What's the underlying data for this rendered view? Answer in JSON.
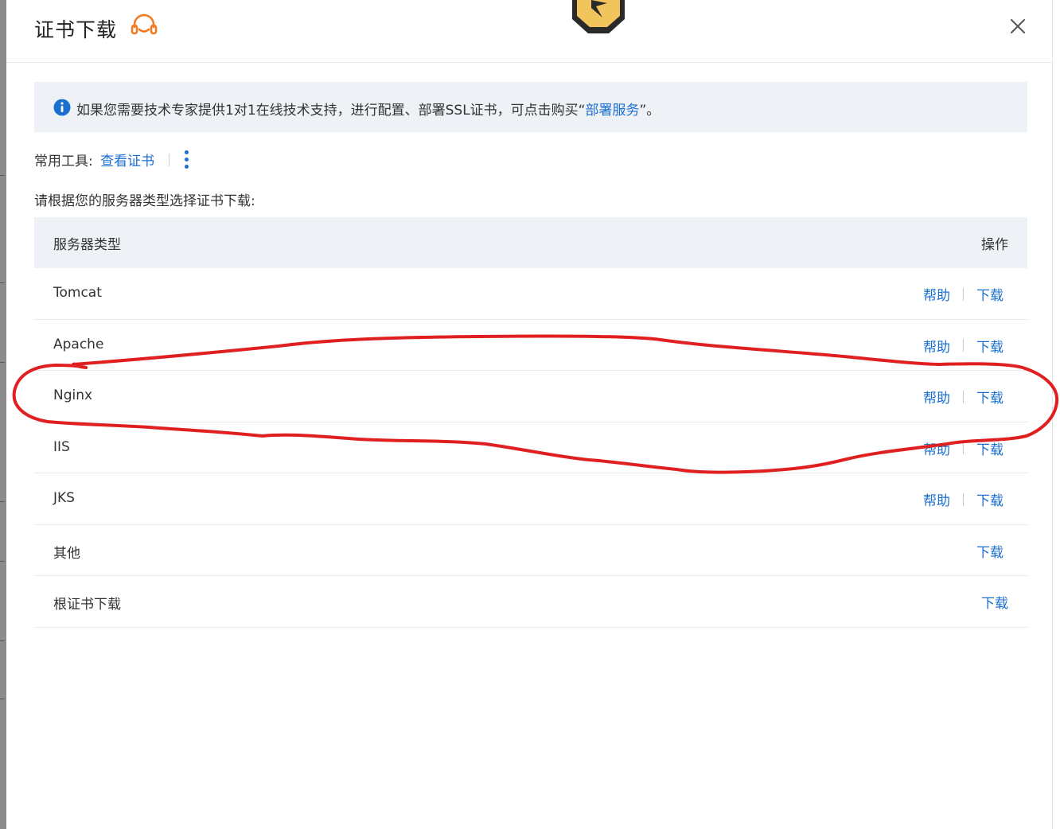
{
  "dialog": {
    "title": "证书下载",
    "close_icon": "close-icon",
    "support_icon": "headset-icon"
  },
  "notice": {
    "icon": "info-icon",
    "text_before": "如果您需要技术专家提供1对1在线技术支持，进行配置、部署SSL证书，可点击购买“",
    "link_text": "部署服务",
    "text_after": "”。"
  },
  "tools": {
    "label": "常用工具:",
    "view_cert": "查看证书",
    "more_icon": "more-vertical-icon"
  },
  "instruction": "请根据您的服务器类型选择证书下载:",
  "table": {
    "col_type": "服务器类型",
    "col_op": "操作",
    "rows": [
      {
        "name": "Tomcat",
        "help": "帮助",
        "download": "下载"
      },
      {
        "name": "Apache",
        "help": "帮助",
        "download": "下载"
      },
      {
        "name": "Nginx",
        "help": "帮助",
        "download": "下载"
      },
      {
        "name": "IIS",
        "help": "帮助",
        "download": "下载"
      },
      {
        "name": "JKS",
        "help": "帮助",
        "download": "下载"
      },
      {
        "name": "其他",
        "download": "下载"
      },
      {
        "name": "根证书下载",
        "download": "下载"
      }
    ]
  },
  "colors": {
    "accent": "#1a6fd1",
    "support_icon": "#f47a1f",
    "annotation": "#e02020"
  }
}
